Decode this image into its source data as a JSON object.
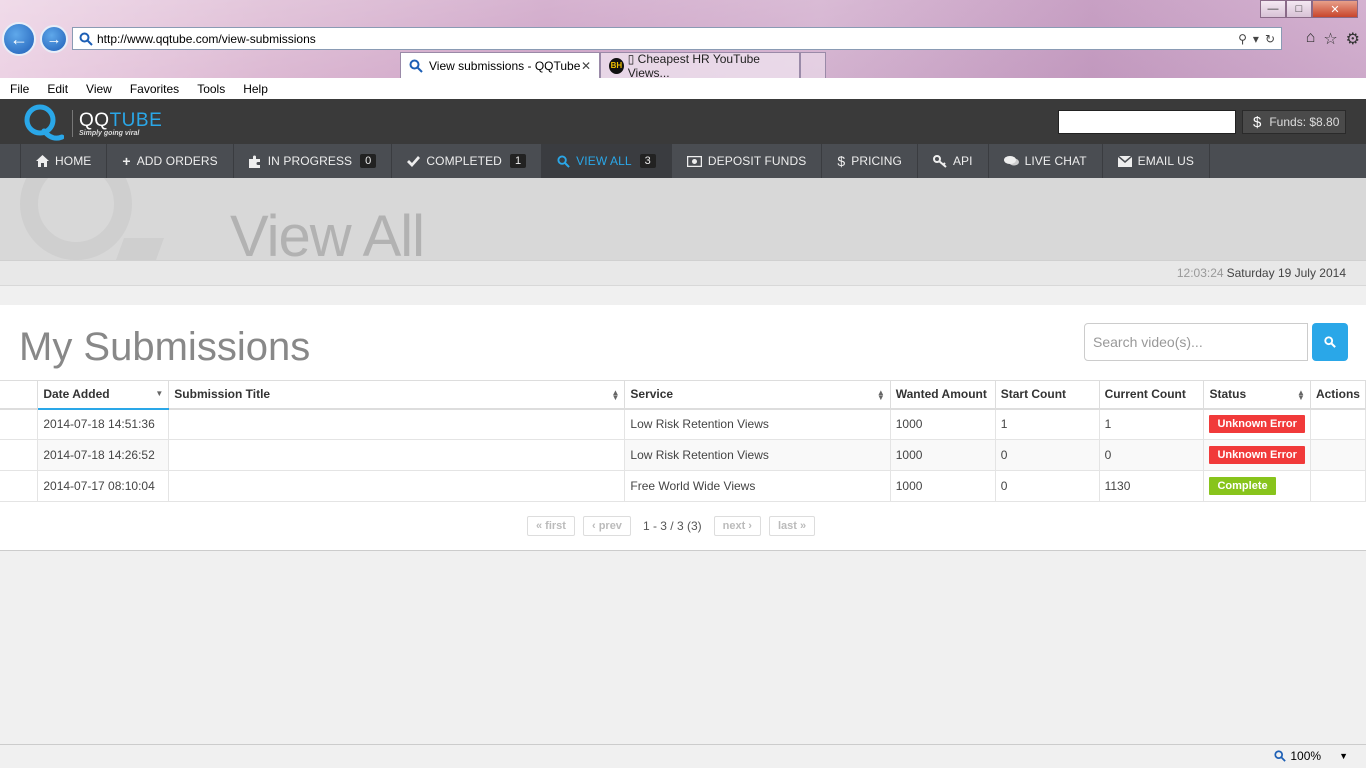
{
  "browser": {
    "url": "http://www.qqtube.com/view-submissions",
    "tabs": [
      {
        "title": "View submissions - QQTube",
        "active": true
      },
      {
        "title": "▯ Cheapest HR YouTube Views...",
        "active": false
      }
    ],
    "menu": [
      "File",
      "Edit",
      "View",
      "Favorites",
      "Tools",
      "Help"
    ],
    "zoom": "100%"
  },
  "header": {
    "logo_main": "QQ",
    "logo_accent": "TUBE",
    "tagline": "Simply going viral",
    "funds": "Funds: $8.80"
  },
  "nav": [
    {
      "label": "HOME",
      "icon": "home-icon"
    },
    {
      "label": "ADD ORDERS",
      "icon": "plus-icon"
    },
    {
      "label": "IN PROGRESS",
      "icon": "puzzle-icon",
      "count": "0"
    },
    {
      "label": "COMPLETED",
      "icon": "check-icon",
      "count": "1"
    },
    {
      "label": "VIEW ALL",
      "icon": "search-icon",
      "count": "3",
      "active": true
    },
    {
      "label": "DEPOSIT FUNDS",
      "icon": "money-icon"
    },
    {
      "label": "PRICING",
      "icon": "dollar-icon"
    },
    {
      "label": "API",
      "icon": "key-icon"
    },
    {
      "label": "LIVE CHAT",
      "icon": "chat-icon"
    },
    {
      "label": "EMAIL US",
      "icon": "envelope-icon"
    }
  ],
  "page": {
    "title": "View All",
    "time": "12:03:24",
    "date": "Saturday 19 July 2014",
    "heading": "My Submissions",
    "search_placeholder": "Search video(s)..."
  },
  "table": {
    "columns": [
      "Date Added",
      "Submission Title",
      "Service",
      "Wanted Amount",
      "Start Count",
      "Current Count",
      "Status",
      "Actions"
    ],
    "rows": [
      {
        "date": "2014-07-18 14:51:36",
        "title": "",
        "service": "Low Risk Retention Views",
        "wanted": "1000",
        "start": "1",
        "current": "1",
        "status": "Unknown Error",
        "status_type": "error"
      },
      {
        "date": "2014-07-18 14:26:52",
        "title": "",
        "service": "Low Risk Retention Views",
        "wanted": "1000",
        "start": "0",
        "current": "0",
        "status": "Unknown Error",
        "status_type": "error"
      },
      {
        "date": "2014-07-17 08:10:04",
        "title": "",
        "service": "Free World Wide Views",
        "wanted": "1000",
        "start": "0",
        "current": "1130",
        "status": "Complete",
        "status_type": "ok"
      }
    ]
  },
  "pager": {
    "first": "« first",
    "prev": "‹ prev",
    "info": "1 - 3 / 3 (3)",
    "next": "next ›",
    "last": "last »"
  },
  "colors": {
    "accent": "#2aa7e8",
    "error": "#f13a3a",
    "ok": "#88c41c",
    "nav_bg": "#4a4d52",
    "header_bg": "#3a3a3a"
  }
}
